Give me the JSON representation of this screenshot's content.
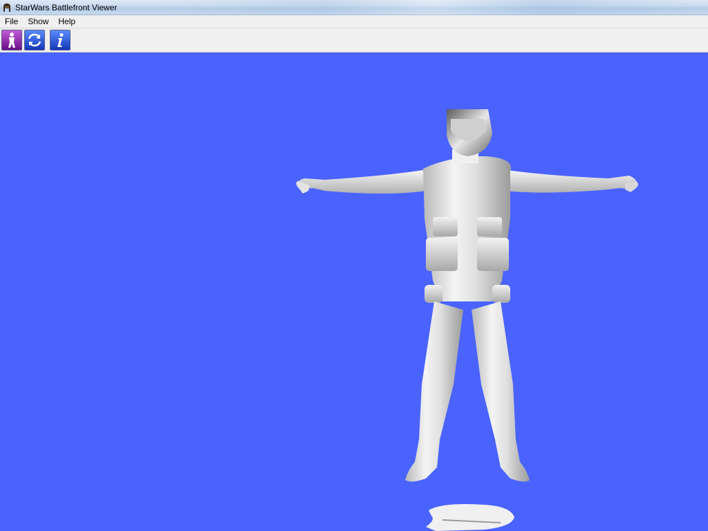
{
  "window": {
    "title": "StarWars Battlefront Viewer",
    "icon": "helmet-icon"
  },
  "menu": {
    "items": [
      "File",
      "Show",
      "Help"
    ]
  },
  "toolbar": {
    "buttons": [
      {
        "icon": "person-icon",
        "color": "#8a1fa8"
      },
      {
        "icon": "rotate-icon",
        "color": "#1a4fd0"
      },
      {
        "icon": "info-icon",
        "color": "#1a4fd0"
      }
    ]
  },
  "viewport": {
    "background": "#4a63ff",
    "model": "soldier-model"
  }
}
